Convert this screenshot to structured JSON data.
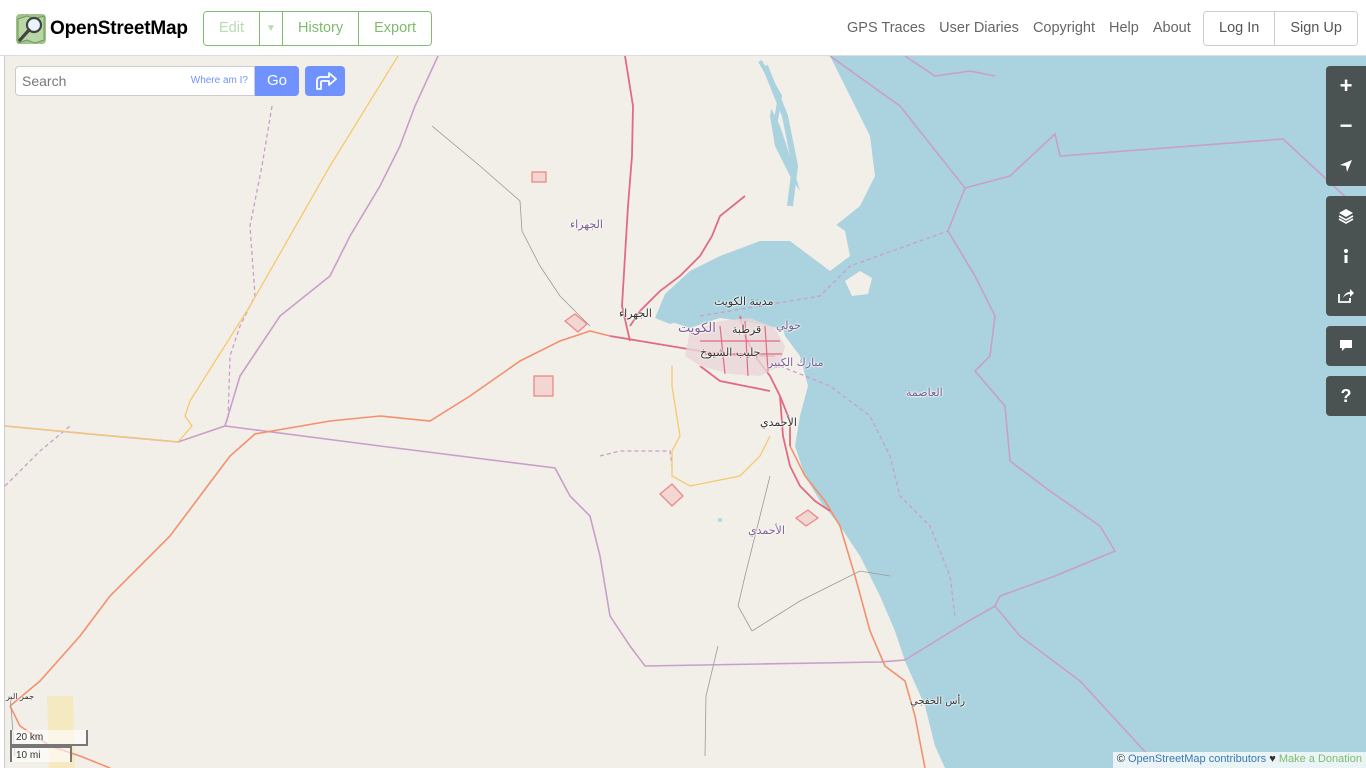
{
  "header": {
    "brand": "OpenStreetMap",
    "edit_label": "Edit",
    "history_label": "History",
    "export_label": "Export",
    "nav": [
      "GPS Traces",
      "User Diaries",
      "Copyright",
      "Help",
      "About"
    ],
    "login_label": "Log In",
    "signup_label": "Sign Up"
  },
  "search": {
    "placeholder": "Search",
    "where_am_i": "Where am I?",
    "go_label": "Go"
  },
  "controls": {
    "zoom_in": "+",
    "zoom_out": "−",
    "help": "?"
  },
  "map_labels": {
    "jahra_governorate": "الجهراء",
    "jahra_city": "الجهراء",
    "kuwait_city": "مدينة الكويت",
    "kuwait": "الكويت",
    "qurtuba": "قرطبة",
    "hawalli": "حولي",
    "jleeb": "جليب الشيوخ",
    "mubarak": "مبارك الكبير",
    "ahmadi_city": "الأحمدي",
    "ahmadi_governorate": "الأحمدي",
    "capital": "العاصمة",
    "ras_khafji": "رأس الخفجي",
    "sw_corner": "جمر البر"
  },
  "scale": {
    "metric": "20 km",
    "imperial": "10 mi"
  },
  "attribution": {
    "prefix": "©",
    "contributors": "OpenStreetMap contributors",
    "heart": "♥",
    "donate": "Make a Donation"
  },
  "colors": {
    "osm_green": "#7ebc6f",
    "search_blue": "#7092ff",
    "water": "#aad3df",
    "land": "#f2efe9",
    "primary_road": "#e892a2",
    "secondary_road": "#f9b29c",
    "tertiary_road": "#f7d496",
    "admin_border": "#c99fc9",
    "controls_bg": "#4a5352"
  }
}
